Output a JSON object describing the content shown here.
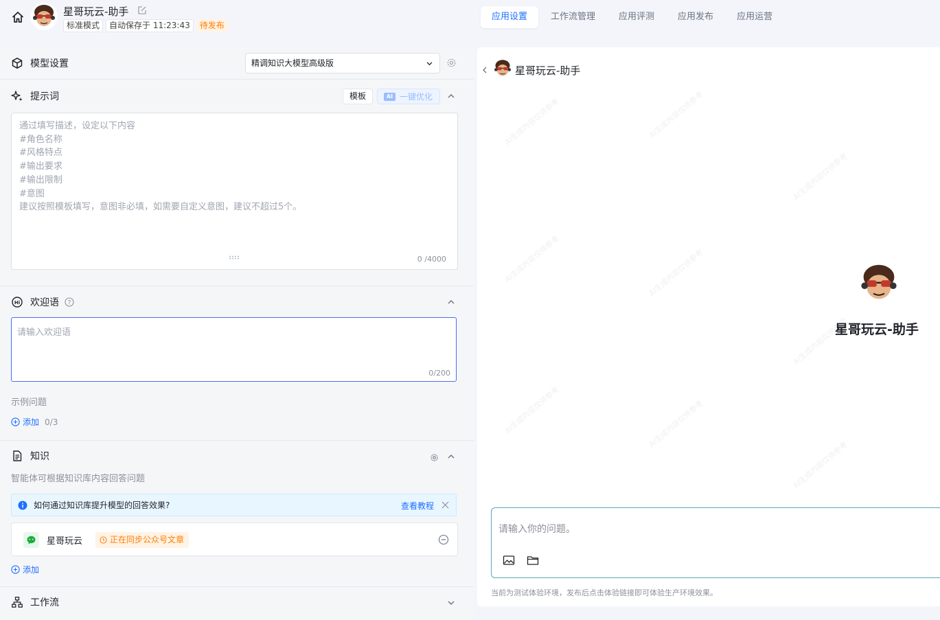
{
  "header": {
    "app_title": "星哥玩云-助手",
    "chips": [
      "标准模式",
      "自动保存于 11:23:43",
      "待发布"
    ],
    "tabs": [
      "应用设置",
      "工作流管理",
      "应用评测",
      "应用发布",
      "应用运营"
    ],
    "active_tab": "应用设置"
  },
  "model": {
    "label": "模型设置",
    "selected": "精调知识大模型高级版"
  },
  "prompt": {
    "label": "提示词",
    "template_button": "模板",
    "optimize_button": "一键优化",
    "ai_badge": "AI",
    "placeholder_lines": [
      "通过填写描述，设定以下内容",
      "#角色名称",
      "#风格特点",
      "#输出要求",
      "#输出限制",
      "#意图",
      "建议按照模板填写，意图非必填，如需要自定义意图，建议不超过5个。"
    ],
    "counter": "0 /4000"
  },
  "welcome": {
    "label": "欢迎语",
    "help_icon": "?",
    "placeholder": "请输入欢迎语",
    "counter": "0/200",
    "examples_label": "示例问题",
    "add_label": "添加",
    "add_count": "0/3"
  },
  "knowledge": {
    "label": "知识",
    "description": "智能体可根据知识库内容回答问题",
    "tip_text": "如何通过知识库提升模型的回答效果?",
    "tip_link": "查看教程",
    "items": [
      {
        "name": "星哥玩云",
        "status": "正在同步公众号文章"
      }
    ],
    "add_label": "添加"
  },
  "workflow": {
    "label": "工作流"
  },
  "preview": {
    "title": "星哥玩云-助手",
    "center_name": "星哥玩云-助手",
    "input_placeholder": "请输入你的问题。",
    "env_note": "当前为测试体验环境，发布后点击体验链接即可体验生产环境效果。",
    "watermark": "AI生成内容仅供参考"
  },
  "colors": {
    "accent": "#1f6fff",
    "pending": "#ff7d00",
    "input_focus": "#4b6cf0"
  }
}
